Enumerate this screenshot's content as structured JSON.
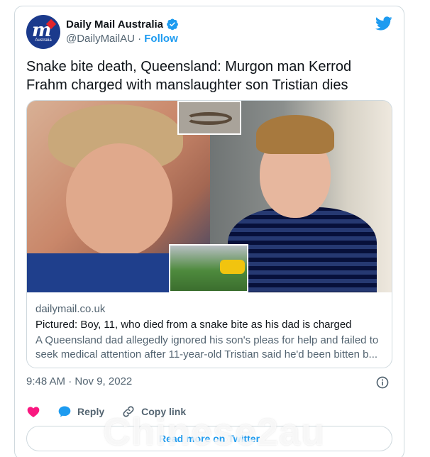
{
  "account": {
    "name": "Daily Mail Australia",
    "handle": "@DailyMailAU",
    "separator": "·",
    "follow_label": "Follow",
    "avatar_text": "m",
    "avatar_subtext": "Australia"
  },
  "tweet": {
    "text": "Snake bite death, Queensland: Murgon man Kerrod Frahm charged with manslaughter son Tristian dies"
  },
  "link_card": {
    "domain": "dailymail.co.uk",
    "title": "Pictured: Boy, 11, who died from a snake bite as his dad is charged",
    "description": "A Queensland dad allegedly ignored his son's pleas for help and failed to seek medical attention after 11-year-old Tristian said he'd been bitten b..."
  },
  "timestamp": "9:48 AM · Nov 9, 2022",
  "actions": {
    "reply_label": "Reply",
    "copy_link_label": "Copy link"
  },
  "read_more_label": "Read more on Twitter",
  "watermark": "Chinese2au",
  "colors": {
    "twitter_blue": "#1d9bf0",
    "like_pink": "#f91880",
    "text_primary": "#0f1419",
    "text_secondary": "#536471",
    "border": "#cfd9de"
  },
  "icons": [
    "verified-badge-icon",
    "twitter-bird-icon",
    "info-icon",
    "heart-icon",
    "reply-icon",
    "link-icon"
  ]
}
